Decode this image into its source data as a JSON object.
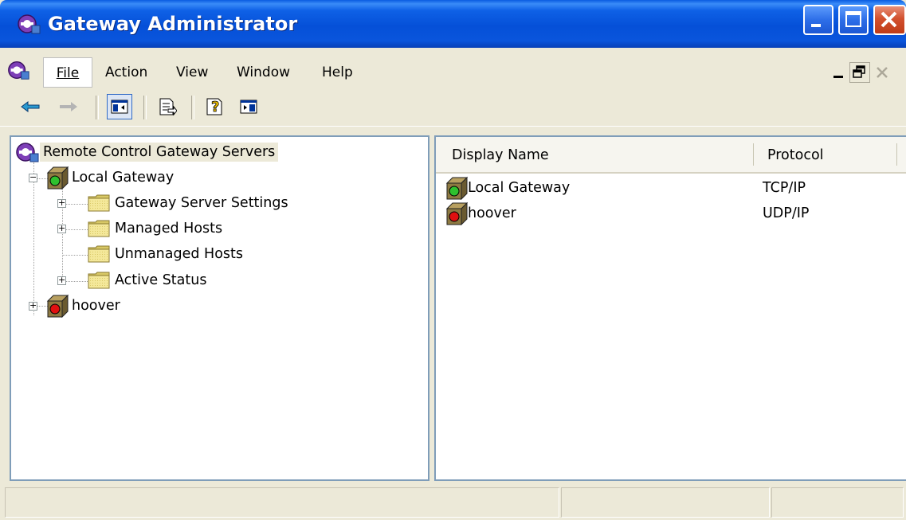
{
  "window": {
    "title": "Gateway Administrator",
    "icon": "gateway-admin-icon"
  },
  "menu": {
    "items": [
      {
        "label": "File",
        "mnemonic": "F"
      },
      {
        "label": "Action",
        "mnemonic": "A"
      },
      {
        "label": "View",
        "mnemonic": "V"
      },
      {
        "label": "Window",
        "mnemonic": "W"
      },
      {
        "label": "Help",
        "mnemonic": "H"
      }
    ]
  },
  "toolbar": {
    "buttons": [
      "back-arrow-icon",
      "forward-arrow-icon",
      "show-hide-console-tree-icon",
      "export-list-icon",
      "help-icon",
      "show-hide-action-pane-icon"
    ]
  },
  "tree": {
    "root": "Remote Control Gateway Servers",
    "nodes": [
      {
        "label": "Local Gateway",
        "status": "green"
      },
      {
        "label": "Gateway Server Settings"
      },
      {
        "label": "Managed Hosts"
      },
      {
        "label": "Unmanaged Hosts"
      },
      {
        "label": "Active Status"
      },
      {
        "label": "hoover",
        "status": "red"
      }
    ]
  },
  "list": {
    "columns": [
      "Display Name",
      "Protocol"
    ],
    "rows": [
      {
        "name": "Local Gateway",
        "protocol": "TCP/IP",
        "status": "green"
      },
      {
        "name": "hoover",
        "protocol": "UDP/IP",
        "status": "red"
      }
    ]
  },
  "colors": {
    "titlebar": "#0a55dc",
    "selection": "#ece9d8",
    "status_green": "#2ec12e",
    "status_red": "#e01010",
    "folder": "#efe08a"
  }
}
